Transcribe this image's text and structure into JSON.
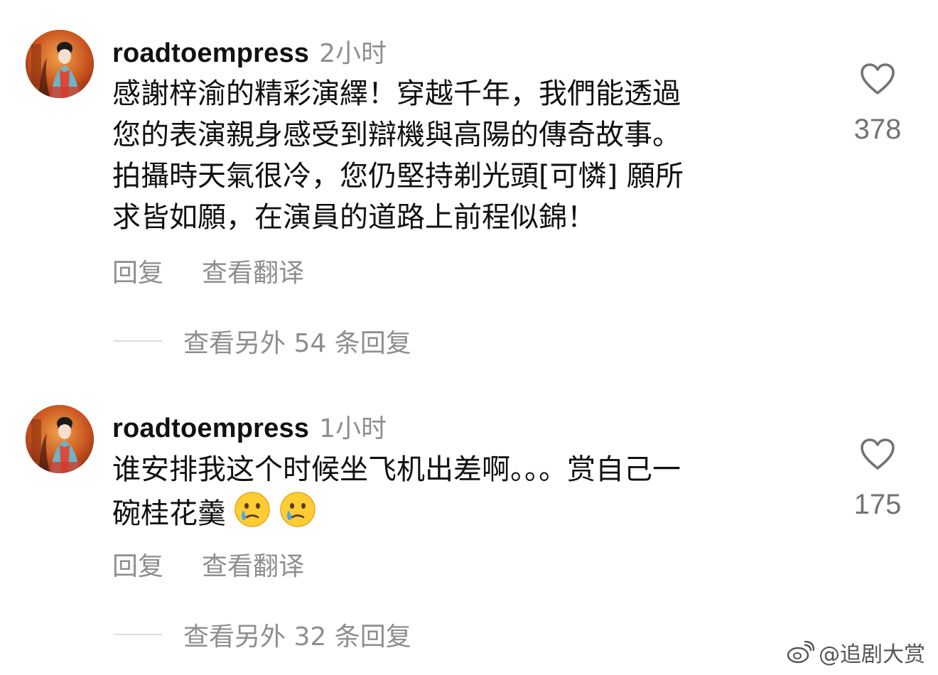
{
  "comments": [
    {
      "username": "roadtoempress",
      "time": "2小时",
      "text_lines": [
        "感謝梓渝的精彩演繹！穿越千年，我們能透過",
        "您的表演親身感受到辯機與高陽的傳奇故事。",
        "拍攝時天氣很冷，您仍堅持剃光頭[可憐] 願所",
        "求皆如願，在演員的道路上前程似錦！"
      ],
      "reply_label": "回复",
      "translate_label": "查看翻译",
      "more_replies": "查看另外 54 条回复",
      "likes": "378"
    },
    {
      "username": "roadtoempress",
      "time": "1小时",
      "text_lines": [
        "谁安排我这个时候坐飞机出差啊。。。赏自己一",
        "碗桂花羹"
      ],
      "emojis": [
        "crying-face-emoji",
        "crying-face-emoji"
      ],
      "reply_label": "回复",
      "translate_label": "查看翻译",
      "more_replies": "查看另外 32 条回复",
      "likes": "175"
    }
  ],
  "watermark": {
    "text": "@追剧大赏",
    "icon": "weibo-logo"
  },
  "colors": {
    "primary_text": "#111111",
    "secondary_text": "#8e8e8e",
    "like_count": "#737373",
    "divider": "#dbdbdb"
  }
}
